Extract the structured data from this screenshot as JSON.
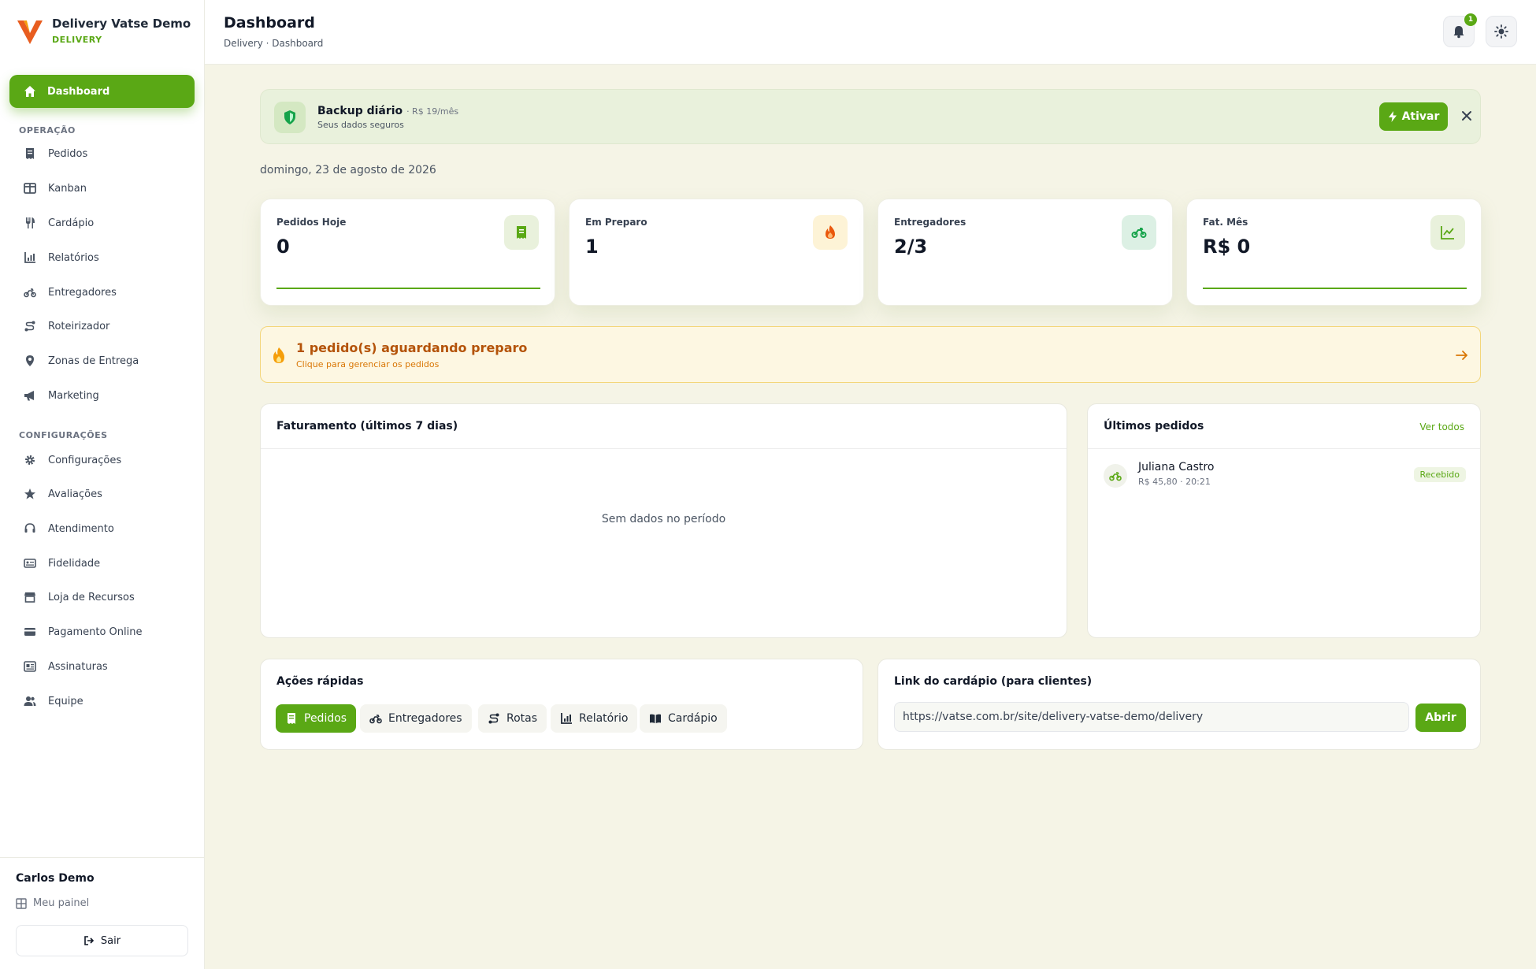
{
  "brand": {
    "name": "Delivery Vatse Demo",
    "subtitle": "DELIVERY"
  },
  "sidebar": {
    "active": {
      "label": "Dashboard",
      "icon": "home-icon"
    },
    "sections": [
      {
        "title": "OPERAÇÃO",
        "items": [
          {
            "label": "Pedidos",
            "icon": "receipt-icon"
          },
          {
            "label": "Kanban",
            "icon": "kanban-icon"
          },
          {
            "label": "Cardápio",
            "icon": "utensils-icon"
          },
          {
            "label": "Relatórios",
            "icon": "chart-icon"
          },
          {
            "label": "Entregadores",
            "icon": "motorcycle-icon"
          },
          {
            "label": "Roteirizador",
            "icon": "route-icon"
          },
          {
            "label": "Zonas de Entrega",
            "icon": "map-pin-icon"
          },
          {
            "label": "Marketing",
            "icon": "megaphone-icon"
          }
        ]
      },
      {
        "title": "CONFIGURAÇÕES",
        "items": [
          {
            "label": "Configurações",
            "icon": "gear-icon"
          },
          {
            "label": "Avaliações",
            "icon": "star-icon"
          },
          {
            "label": "Atendimento",
            "icon": "headset-icon"
          },
          {
            "label": "Fidelidade",
            "icon": "id-card-icon"
          },
          {
            "label": "Loja de Recursos",
            "icon": "store-icon"
          },
          {
            "label": "Pagamento Online",
            "icon": "credit-card-icon"
          },
          {
            "label": "Assinaturas",
            "icon": "subscription-icon"
          },
          {
            "label": "Equipe",
            "icon": "users-icon"
          }
        ]
      }
    ],
    "user": {
      "name": "Carlos Demo",
      "panel_label": "Meu painel",
      "logout_label": "Sair"
    }
  },
  "header": {
    "title": "Dashboard",
    "breadcrumb": "Delivery · Dashboard",
    "notification_count": "1"
  },
  "backup": {
    "title": "Backup diário",
    "price": "· R$ 19/mês",
    "subtitle": "Seus dados seguros",
    "button": "Ativar"
  },
  "date": "domingo, 23 de agosto de 2026",
  "stats": [
    {
      "label": "Pedidos Hoje",
      "value": "0",
      "icon": "receipt-icon",
      "bg": "#e9f1dc",
      "fg": "#5aa815"
    },
    {
      "label": "Em Preparo",
      "value": "1",
      "icon": "fire-icon",
      "bg": "#fdf3d6",
      "fg": "#ea580c"
    },
    {
      "label": "Entregadores",
      "value": "2/3",
      "icon": "motorcycle-icon",
      "bg": "#dcf0e4",
      "fg": "#16a34a"
    },
    {
      "label": "Fat. Mês",
      "value": "R$ 0",
      "icon": "trend-icon",
      "bg": "#e9f1dc",
      "fg": "#5aa815"
    }
  ],
  "alert": {
    "title": "1 pedido(s) aguardando preparo",
    "subtitle": "Clique para gerenciar os pedidos"
  },
  "revenue": {
    "title": "Faturamento (últimos 7 dias)",
    "empty": "Sem dados no período"
  },
  "latest": {
    "title": "Últimos pedidos",
    "link": "Ver todos",
    "orders": [
      {
        "name": "Juliana Castro",
        "meta": "R$ 45,80 · 20:21",
        "status": "Recebido"
      }
    ]
  },
  "quick_actions": {
    "title": "Ações rápidas",
    "items": [
      {
        "label": "Pedidos",
        "icon": "receipt-icon"
      },
      {
        "label": "Entregadores",
        "icon": "motorcycle-icon"
      },
      {
        "label": "Rotas",
        "icon": "route-icon"
      },
      {
        "label": "Relatório",
        "icon": "chart-icon"
      },
      {
        "label": "Cardápio",
        "icon": "book-icon"
      }
    ]
  },
  "menu_link": {
    "title": "Link do cardápio (para clientes)",
    "url": "https://vatse.com.br/site/delivery-vatse-demo/delivery",
    "button": "Abrir"
  },
  "colors": {
    "accent": "#5aa815",
    "background": "#f5f4e6",
    "warning": "#d97706"
  }
}
